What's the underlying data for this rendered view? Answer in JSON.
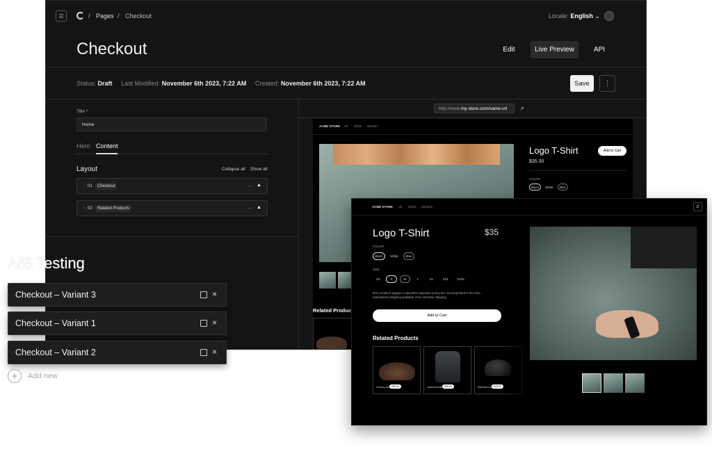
{
  "topbar": {
    "breadcrumb": [
      "Pages",
      "Checkout"
    ],
    "sep": "/",
    "locale_label": "Locale:",
    "locale_value": "English"
  },
  "header": {
    "title": "Checkout",
    "tabs": [
      "Edit",
      "Live Preview",
      "API"
    ],
    "active_tab": "Live Preview"
  },
  "status": {
    "status_label": "Status:",
    "status_value": "Draft",
    "modified_label": "Last Modified:",
    "modified_value": "November 6th 2023, 7:22 AM",
    "created_label": "Created:",
    "created_value": "November 6th 2023, 7:22 AM",
    "save_label": "Save"
  },
  "editor": {
    "title_label": "Title *",
    "title_value": "Home",
    "tabs": [
      "Hero",
      "Content"
    ],
    "active_tab": "Content",
    "layout_label": "Layout",
    "collapse_all": "Collapse all",
    "show_all": "Show all",
    "blocks": [
      {
        "num": "01",
        "name": "Checkout"
      },
      {
        "num": "02",
        "name": "Related Products"
      }
    ],
    "dash": "--"
  },
  "preview": {
    "url_prefix": "http://www.",
    "url_host": "my-store.com/same-url",
    "store_name": "ACME STORE",
    "nav": [
      "All",
      "Shirts",
      "Stickers"
    ],
    "back": {
      "product": "Logo T-Shirt",
      "price": "$35.00",
      "add_to_cart": "Add to Cart",
      "color_label": "COLOR",
      "colors": [
        "Black",
        "White",
        "Blue"
      ],
      "related": "Related Products"
    },
    "front": {
      "product": "Logo T-Shirt",
      "price": "$35",
      "color_label": "COLOR",
      "colors": [
        "Black",
        "White",
        "Blue"
      ],
      "size_label": "SIZE",
      "sizes": [
        "XS",
        "S",
        "M",
        "L",
        "XL",
        "XXL",
        "XXXL"
      ],
      "description": "60% combed ringspun cotton/40% polyester jersey tee. Screenprinted in the USA. International shipping available. Free domestic shipping.",
      "add_to_cart": "Add to Cart",
      "related": "Related Products",
      "related_items": [
        {
          "name": "Cowboy Hat",
          "price": "$35.00"
        },
        {
          "name": "Jacket/Hoodie",
          "price": "$45.00"
        },
        {
          "name": "Baseball Cap",
          "price": "$25.00"
        }
      ]
    }
  },
  "ab": {
    "title": "A/B Testing",
    "variants": [
      "Checkout – Variant 3",
      "Checkout – Variant 1",
      "Checkout – Variant 2"
    ],
    "add_new": "Add new"
  }
}
